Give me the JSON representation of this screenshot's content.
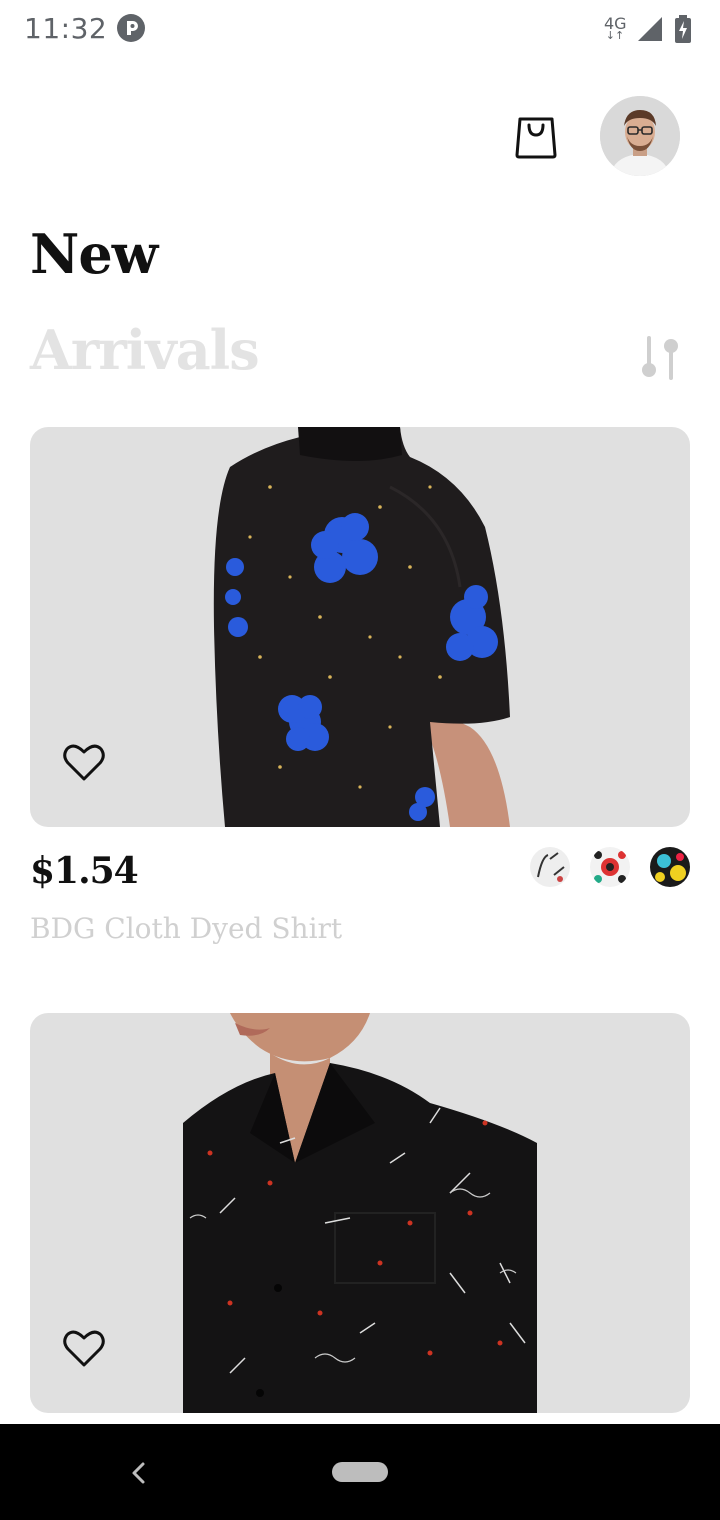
{
  "status_bar": {
    "time": "11:32",
    "network_label": "4G",
    "icons": [
      "app-notification-icon",
      "network-4g-icon",
      "signal-icon",
      "battery-charging-icon"
    ]
  },
  "header": {
    "icons": [
      "shopping-bag-icon",
      "avatar"
    ]
  },
  "titles": {
    "line1": "New",
    "line2": "Arrivals"
  },
  "products": [
    {
      "price": "$1.54",
      "name": "BDG Cloth Dyed Shirt",
      "favorite": false,
      "swatch_count": 3
    },
    {
      "favorite": false
    }
  ],
  "colors": {
    "card_background": "#e0e0e0",
    "title_primary": "#111111",
    "title_secondary": "#e3e3e3",
    "muted_text": "#d0d0d0",
    "accent_blue": "#2a5bdc"
  }
}
